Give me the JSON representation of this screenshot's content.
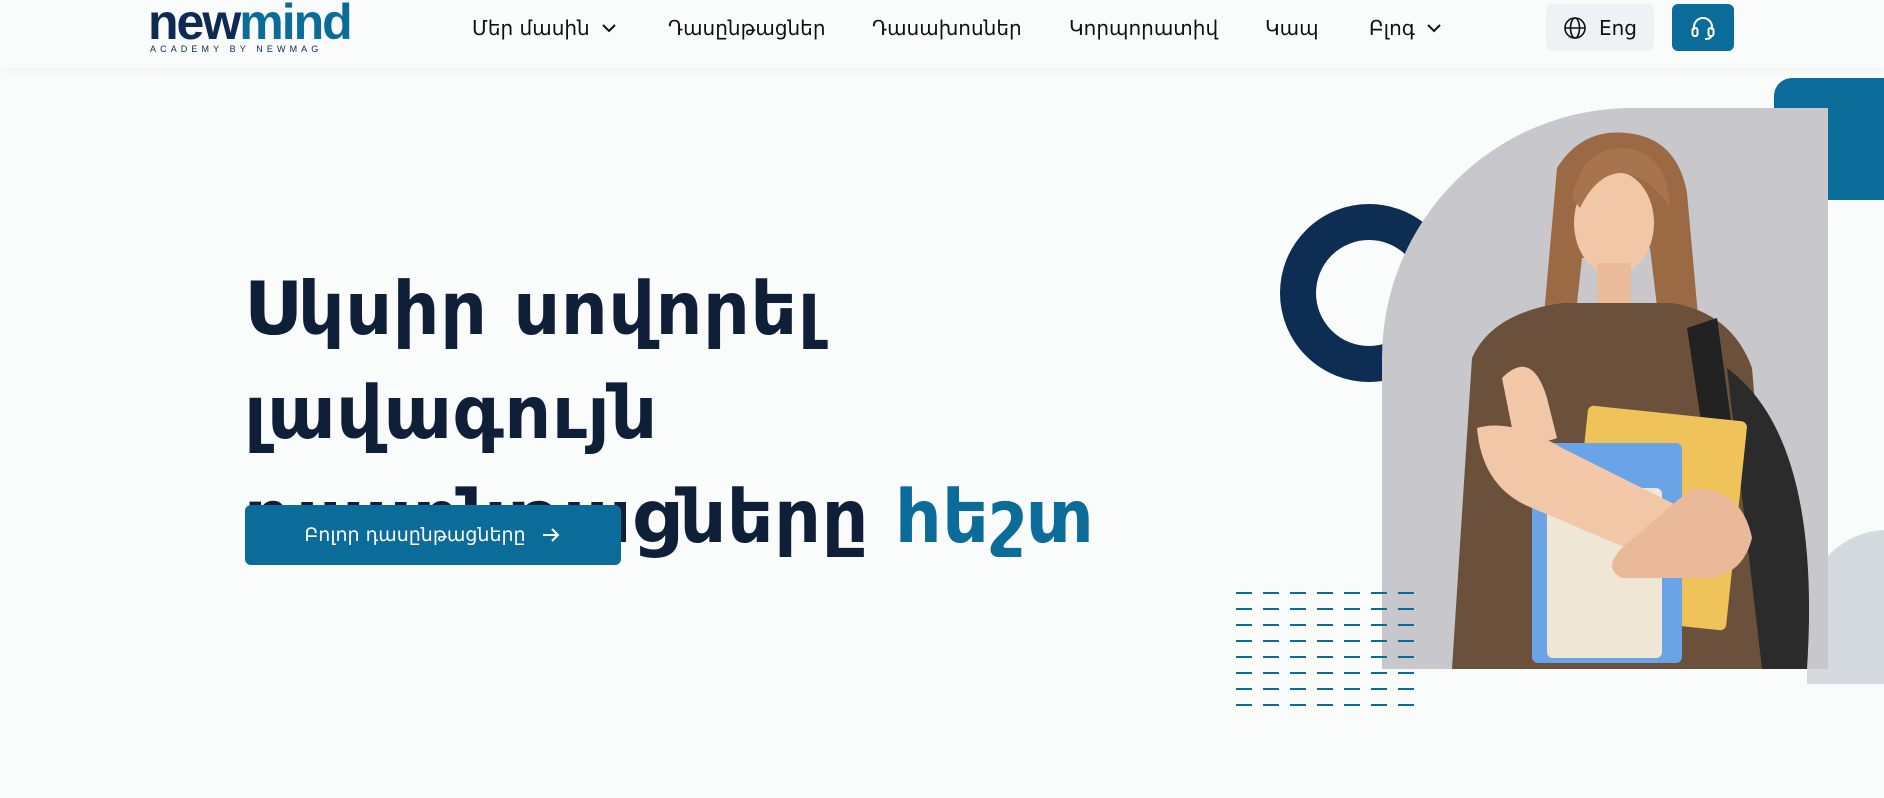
{
  "brand": {
    "name_part1": "new",
    "name_part2": "mind",
    "tagline": "ACADEMY BY NEWMAG"
  },
  "nav": {
    "items": [
      {
        "label": "Մեր մասին",
        "has_dropdown": true
      },
      {
        "label": "Դասընթացներ",
        "has_dropdown": false
      },
      {
        "label": "Դասախոսներ",
        "has_dropdown": false
      },
      {
        "label": "Կորպորատիվ",
        "has_dropdown": false
      },
      {
        "label": "Կապ",
        "has_dropdown": false
      },
      {
        "label": "Բլոգ",
        "has_dropdown": true
      }
    ],
    "language_label": "Eng",
    "support_icon": "headset-icon"
  },
  "hero": {
    "title_line1": "Սկսիր սովորել լավագույն",
    "title_line2": "դասընթացները",
    "title_accent": "հեշտ",
    "cta_label": "Բոլոր դասընթացները"
  },
  "colors": {
    "primary": "#0b6c99",
    "navy": "#0e2d53",
    "text": "#0f1f38",
    "background": "#fafbfb"
  }
}
